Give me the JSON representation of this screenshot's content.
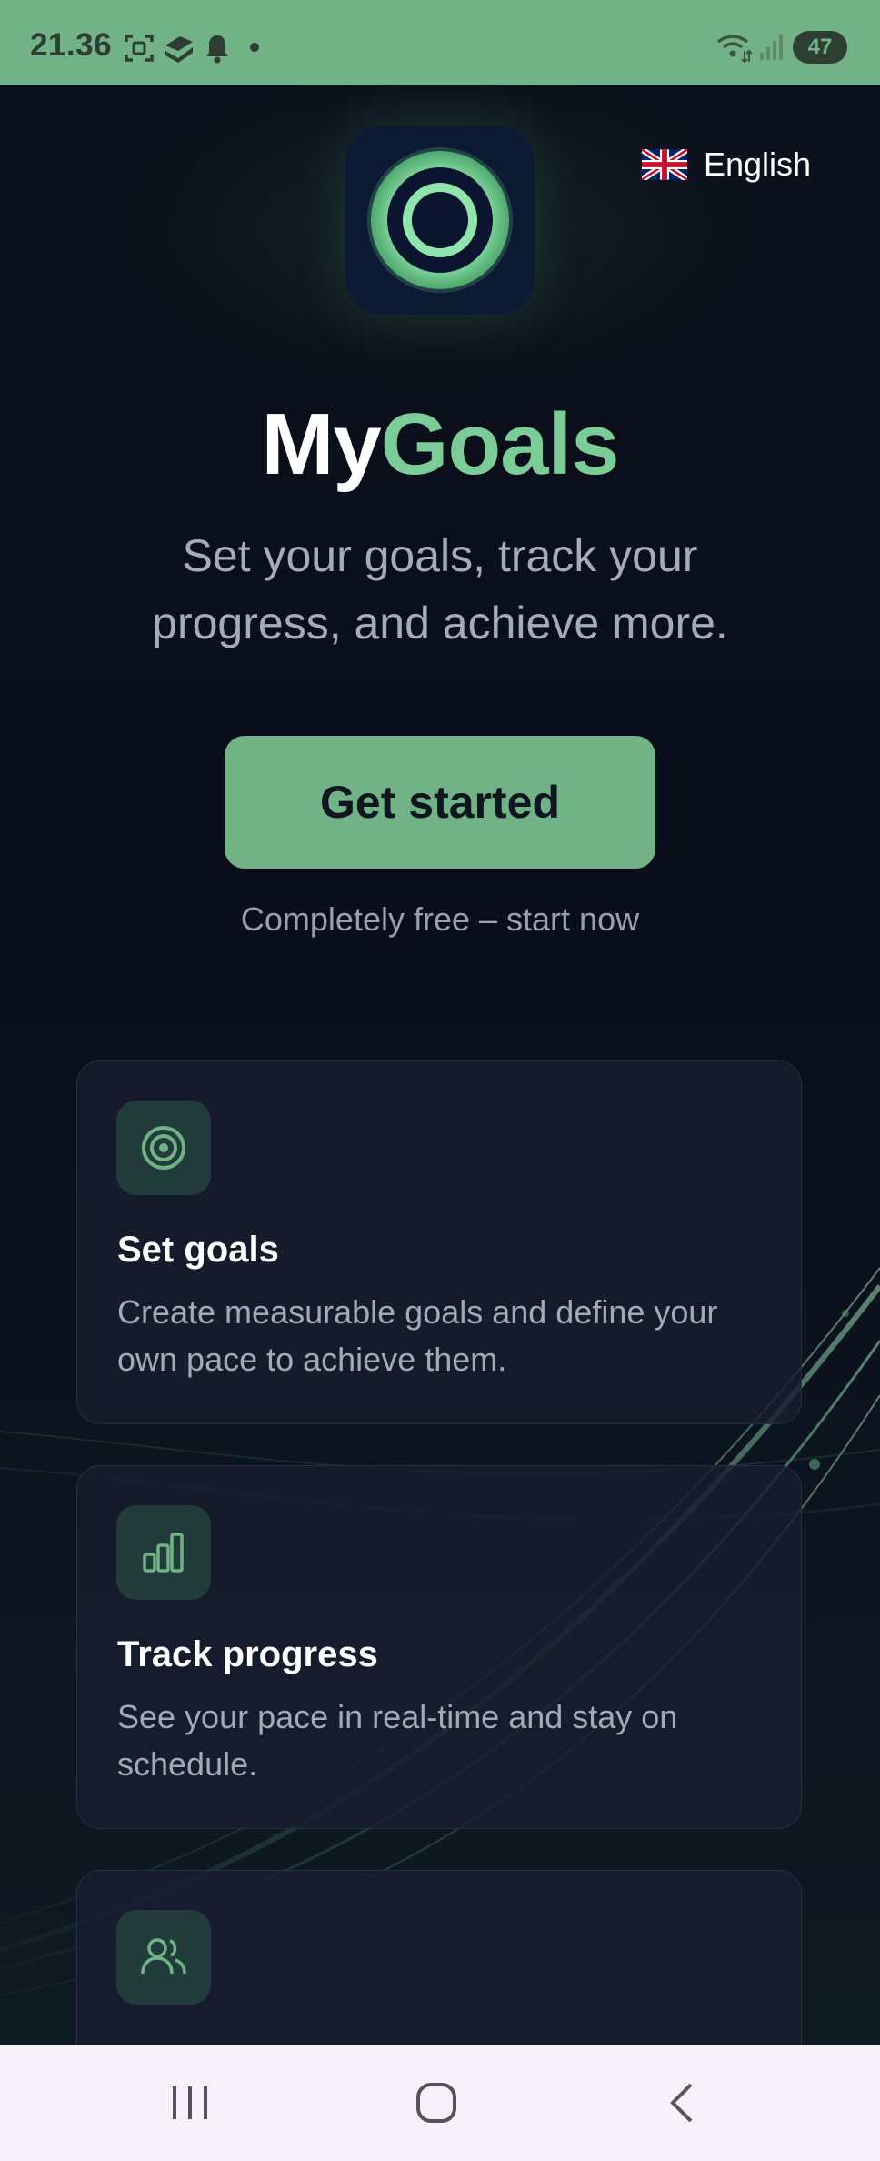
{
  "status_bar": {
    "time": "21.36",
    "battery": "47",
    "icons": [
      "screenshot-icon",
      "layers-icon",
      "bell-icon",
      "dot-icon",
      "wifi-icon",
      "signal-icon",
      "battery-icon"
    ]
  },
  "header": {
    "logo_icon": "target-ring-icon",
    "language": {
      "flag": "uk-flag-icon",
      "label": "English"
    }
  },
  "hero": {
    "title_part1": "My",
    "title_part2": "Goals",
    "subtitle": "Set your goals, track your progress, and achieve more.",
    "cta_label": "Get started",
    "cta_note": "Completely free – start now"
  },
  "features": [
    {
      "icon": "target-icon",
      "title": "Set goals",
      "description": "Create measurable goals and define your own pace to achieve them."
    },
    {
      "icon": "bar-chart-icon",
      "title": "Track progress",
      "description": "See your pace in real-time and stay on schedule."
    },
    {
      "icon": "users-icon",
      "title": "",
      "description": ""
    }
  ],
  "nav_bar": {
    "buttons": [
      "recents-icon",
      "home-icon",
      "back-icon"
    ]
  },
  "colors": {
    "accent": "#72b287",
    "title_accent": "#7ccc98",
    "background": "#0b0f19",
    "card": "#181d30"
  }
}
